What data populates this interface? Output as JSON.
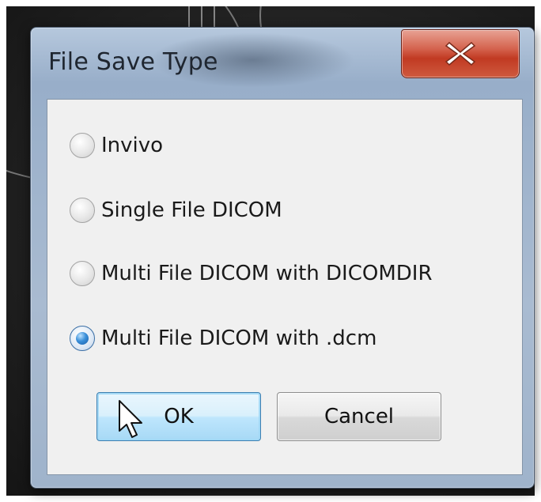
{
  "dialog": {
    "title": "File Save Type",
    "close_icon": "close-x-icon"
  },
  "options": [
    {
      "label": "Invivo",
      "checked": false
    },
    {
      "label": "Single File DICOM",
      "checked": false
    },
    {
      "label": "Multi File DICOM with DICOMDIR",
      "checked": false
    },
    {
      "label": "Multi File DICOM with .dcm",
      "checked": true
    }
  ],
  "buttons": {
    "ok_label": "OK",
    "cancel_label": "Cancel"
  },
  "colors": {
    "close_button": "#c13a22",
    "selected_radio": "#1a5ea8",
    "default_button_border": "#3c7fb1"
  }
}
